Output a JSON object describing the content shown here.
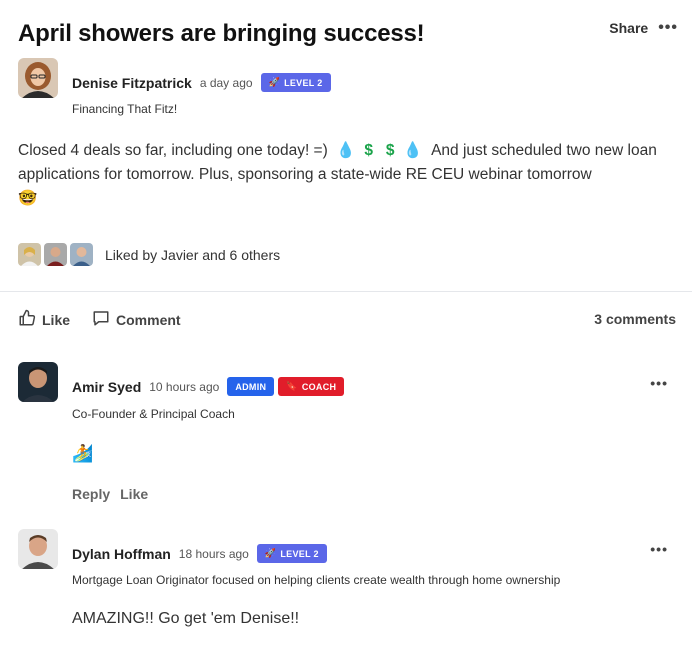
{
  "post": {
    "title": "April showers are bringing success!",
    "share_label": "Share",
    "more_label": "•••",
    "author": {
      "name": "Denise Fitzpatrick",
      "time": "a day ago",
      "badge": "LEVEL 2",
      "subtitle": "Financing That Fitz!"
    },
    "body": {
      "part1": "Closed 4 deals so far, including one today! =)",
      "emoji_drop": "💧",
      "emoji_dollar": "$",
      "part2": "And just scheduled two new loan applications for tomorrow.  Plus, sponsoring a state-wide RE CEU webinar tomorrow",
      "emoji_end": "🤓"
    },
    "liked_by": "Liked by Javier and 6 others",
    "actions": {
      "like_label": "Like",
      "comment_label": "Comment",
      "comment_count": "3 comments"
    }
  },
  "comments": [
    {
      "name": "Amir Syed",
      "time": "10 hours ago",
      "badge_admin": "ADMIN",
      "badge_coach": "COACH",
      "subtitle": "Co-Founder & Principal Coach",
      "emoji": "🏄",
      "reply_label": "Reply",
      "like_label": "Like",
      "more_label": "•••"
    },
    {
      "name": "Dylan Hoffman",
      "time": "18 hours ago",
      "badge": "LEVEL 2",
      "subtitle": "Mortgage Loan Originator focused on helping clients create wealth through home ownership",
      "text": "AMAZING!! Go get 'em Denise!!",
      "more_label": "•••"
    }
  ],
  "colors": {
    "level_badge": "#5b67e8",
    "admin_badge": "#2563eb",
    "coach_badge": "#e11d2a",
    "drop": "#18a0e0",
    "dollar": "#1aa34a"
  }
}
